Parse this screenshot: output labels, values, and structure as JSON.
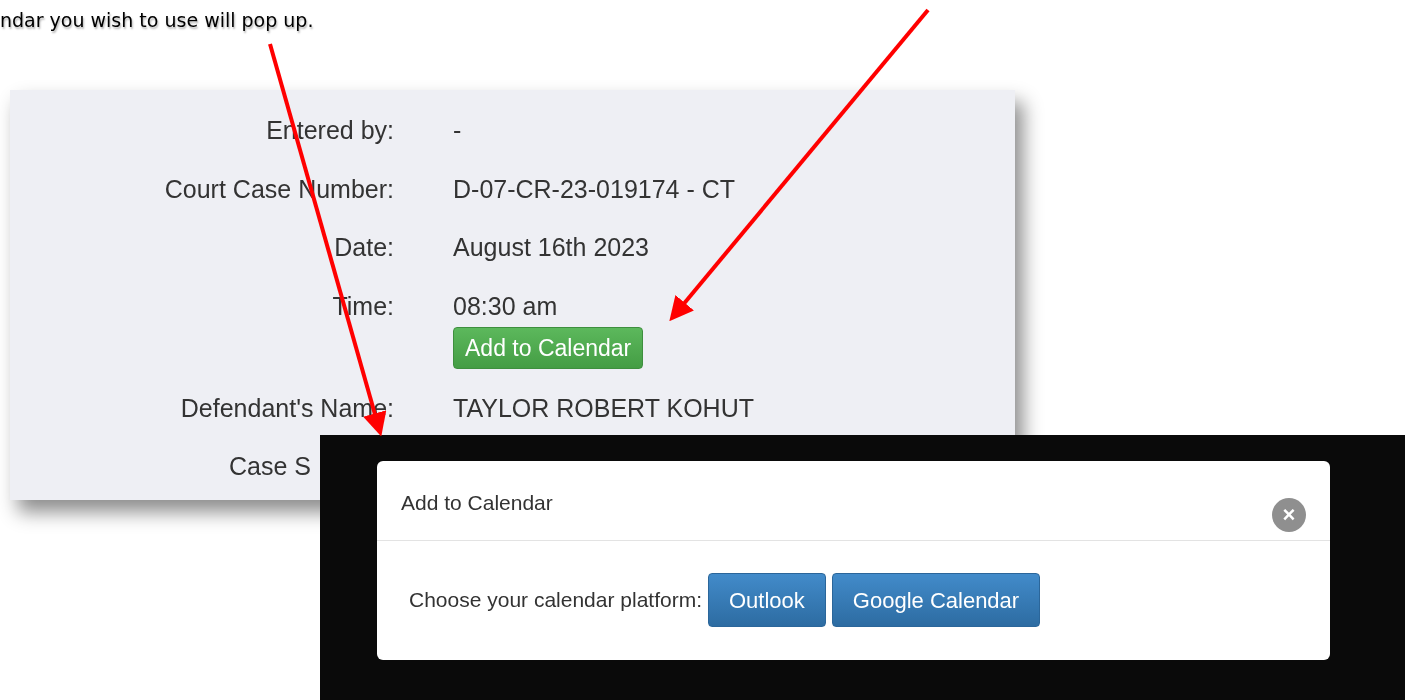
{
  "instruction_text": "ndar you wish to use will pop up.",
  "details": {
    "rows": [
      {
        "kind": "field",
        "label": "Entered by:",
        "value": "-"
      },
      {
        "kind": "field",
        "label": "Court Case Number:",
        "value": "D-07-CR-23-019174 - CT"
      },
      {
        "kind": "field",
        "label": "Date:",
        "value": "August 16th 2023"
      },
      {
        "kind": "field",
        "label": "Time:",
        "value": "08:30 am",
        "button": "Add to Calendar"
      },
      {
        "kind": "field",
        "label": "Defendant's Name:",
        "value": "TAYLOR ROBERT KOHUT"
      },
      {
        "kind": "partial",
        "label": "Case S"
      }
    ]
  },
  "modal": {
    "title": "Add to Calendar",
    "close": "×",
    "prompt": "Choose your calendar platform:",
    "buttons": [
      "Outlook",
      "Google Calendar"
    ]
  }
}
